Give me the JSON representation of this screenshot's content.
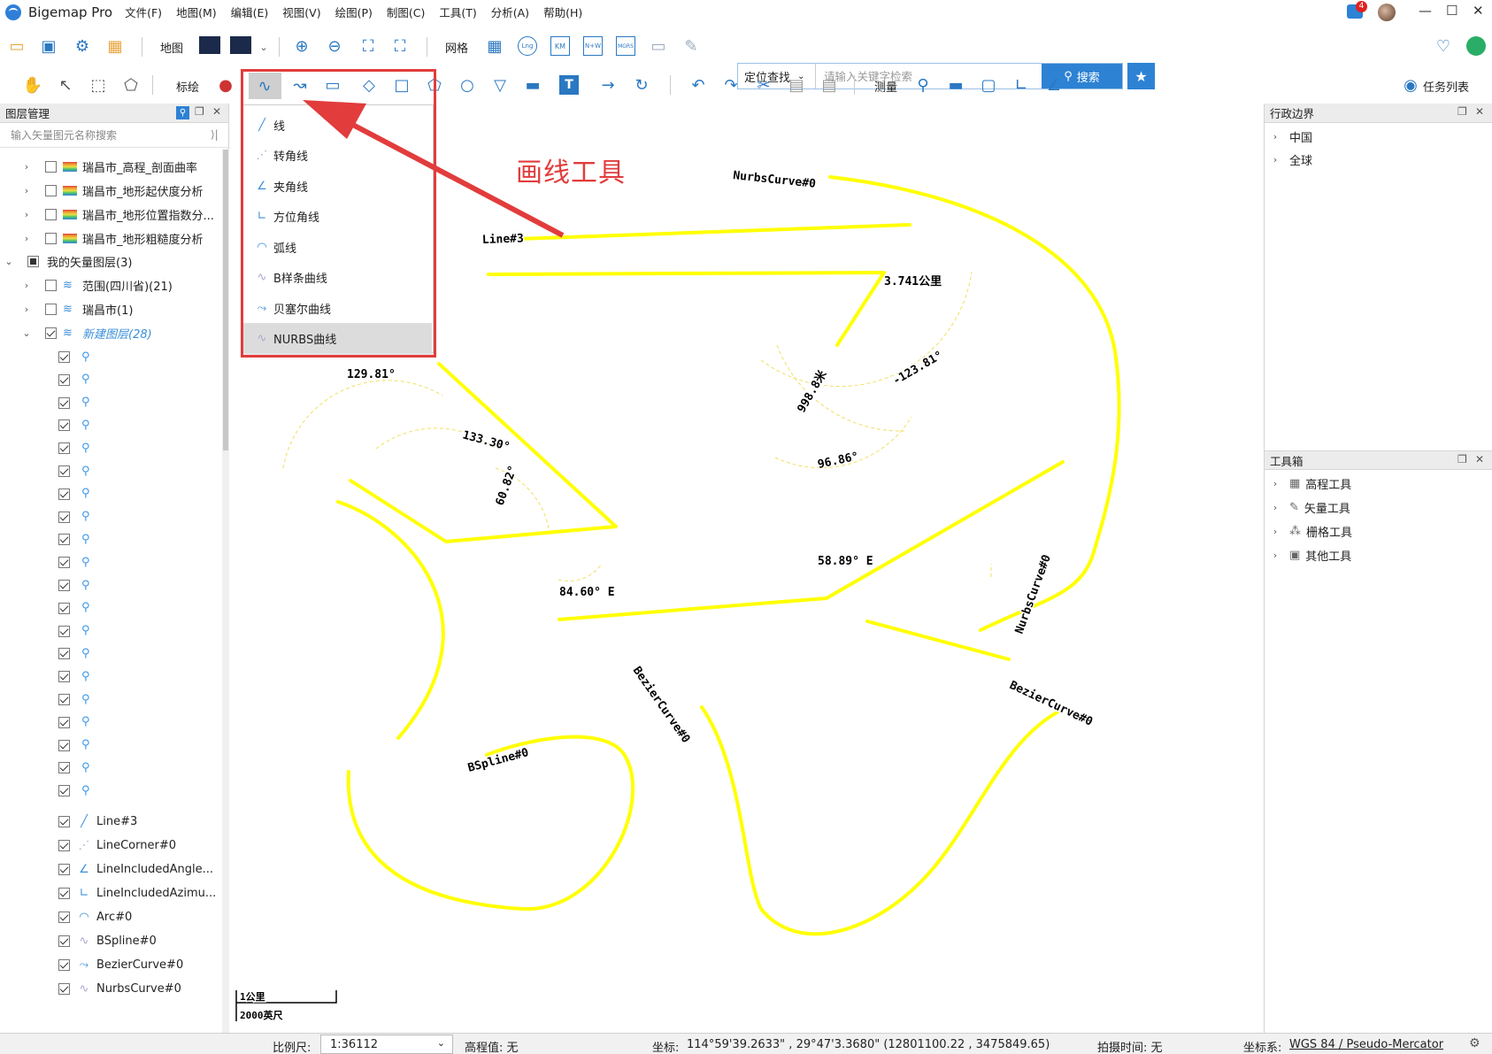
{
  "app": {
    "title": "Bigemap Pro",
    "menu": [
      "文件(F)",
      "地图(M)",
      "编辑(E)",
      "视图(V)",
      "绘图(P)",
      "制图(C)",
      "工具(T)",
      "分析(A)",
      "帮助(H)"
    ],
    "notification_count": "4"
  },
  "toolbar1": {
    "map_label": "地图",
    "grid_label": "网格",
    "grid_badges": [
      "Lng",
      "KM",
      "N+W",
      "MGRS"
    ],
    "locate_select": "定位查找",
    "search_placeholder": "请输入关键字检索",
    "search_button": "搜索"
  },
  "toolbar2": {
    "draw_label": "标绘",
    "measure_label": "测量",
    "task_list": "任务列表"
  },
  "layer_panel": {
    "title": "图层管理",
    "search_placeholder": "输入矢量图元名称搜索",
    "analysis_layers": [
      "瑞昌市_高程_剖面曲率",
      "瑞昌市_地形起伏度分析",
      "瑞昌市_地形位置指数分...",
      "瑞昌市_地形粗糙度分析"
    ],
    "vector_group": "我的矢量图层(3)",
    "vector_layers": [
      "范围(四川省)(21)",
      "瑞昌市(1)",
      "新建图层(28)"
    ],
    "features": [
      "Line#3",
      "LineCorner#0",
      "LineIncludedAngle...",
      "LineIncludedAzimu...",
      "Arc#0",
      "BSpline#0",
      "BezierCurve#0",
      "NurbsCurve#0"
    ]
  },
  "line_dropdown": {
    "items": [
      "线",
      "转角线",
      "夹角线",
      "方位角线",
      "弧线",
      "B样条曲线",
      "贝塞尔曲线",
      "NURBS曲线"
    ],
    "selected": "NURBS曲线"
  },
  "annotation": "画线工具",
  "map": {
    "line_color": "#ffff00",
    "labels": {
      "line3": "Line#3",
      "nurbs_top": "NurbsCurve#0",
      "nurbs_side": "NurbsCurve#0",
      "bezier_left": "BezierCurve#0",
      "bezier_right": "BezierCurve#0",
      "bspline": "BSpline#0",
      "distance": "3.741公里",
      "angle_123": "-123.81°",
      "angle_96": "96.86°",
      "dist_998": "998.8米",
      "angle_129": "129.81°",
      "angle_133": "133.30°",
      "angle_60": "60.82°",
      "bearing_84": "84.60° E",
      "bearing_58": "58.89° E"
    },
    "scale_km": "1公里",
    "scale_ft": "2000英尺"
  },
  "right_panel": {
    "admin_title": "行政边界",
    "admin_items": [
      "中国",
      "全球"
    ],
    "toolbox_title": "工具箱",
    "tools": [
      "高程工具",
      "矢量工具",
      "栅格工具",
      "其他工具"
    ]
  },
  "status": {
    "scale_label": "比例尺:",
    "scale_value": "1:36112",
    "elevation": "高程值: 无",
    "coord_label": "坐标:",
    "coords": "114°59'39.2633\" , 29°47'3.3680\"   (12801100.22 , 3475849.65)",
    "capture_time": "拍摄时间: 无",
    "crs_label": "坐标系:",
    "crs": "WGS 84 / Pseudo-Mercator"
  }
}
